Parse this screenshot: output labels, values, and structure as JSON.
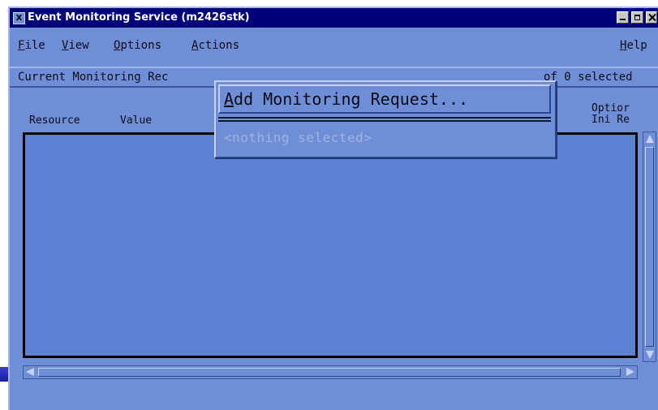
{
  "window": {
    "title": "Event Monitoring Service (m2426stk)",
    "icon_glyph": "X",
    "controls": {
      "minimize": "minimize-icon",
      "maximize": "maximize-icon",
      "close": "close-icon"
    }
  },
  "menubar": {
    "file": {
      "mnemonic": "F",
      "rest": "ile"
    },
    "view": {
      "mnemonic": "V",
      "rest": "iew"
    },
    "options": {
      "mnemonic": "O",
      "rest": "ptions"
    },
    "actions": {
      "mnemonic": "A",
      "rest": "ctions"
    },
    "help": {
      "mnemonic": "H",
      "rest": "elp"
    }
  },
  "status": {
    "label": "Current Monitoring Rec",
    "count": "of 0 selected"
  },
  "columns": {
    "resource": "Resource",
    "value": "Value",
    "options_line1": "Optior",
    "options_line2": "Ini Re"
  },
  "popup": {
    "add_item": {
      "mnemonic": "A",
      "rest": "dd Monitoring Request..."
    },
    "disabled_item": "<nothing selected>"
  },
  "colors": {
    "titlebar": "#00007a",
    "window_bg": "#6e8fd6",
    "list_bg": "#5e82d3"
  }
}
